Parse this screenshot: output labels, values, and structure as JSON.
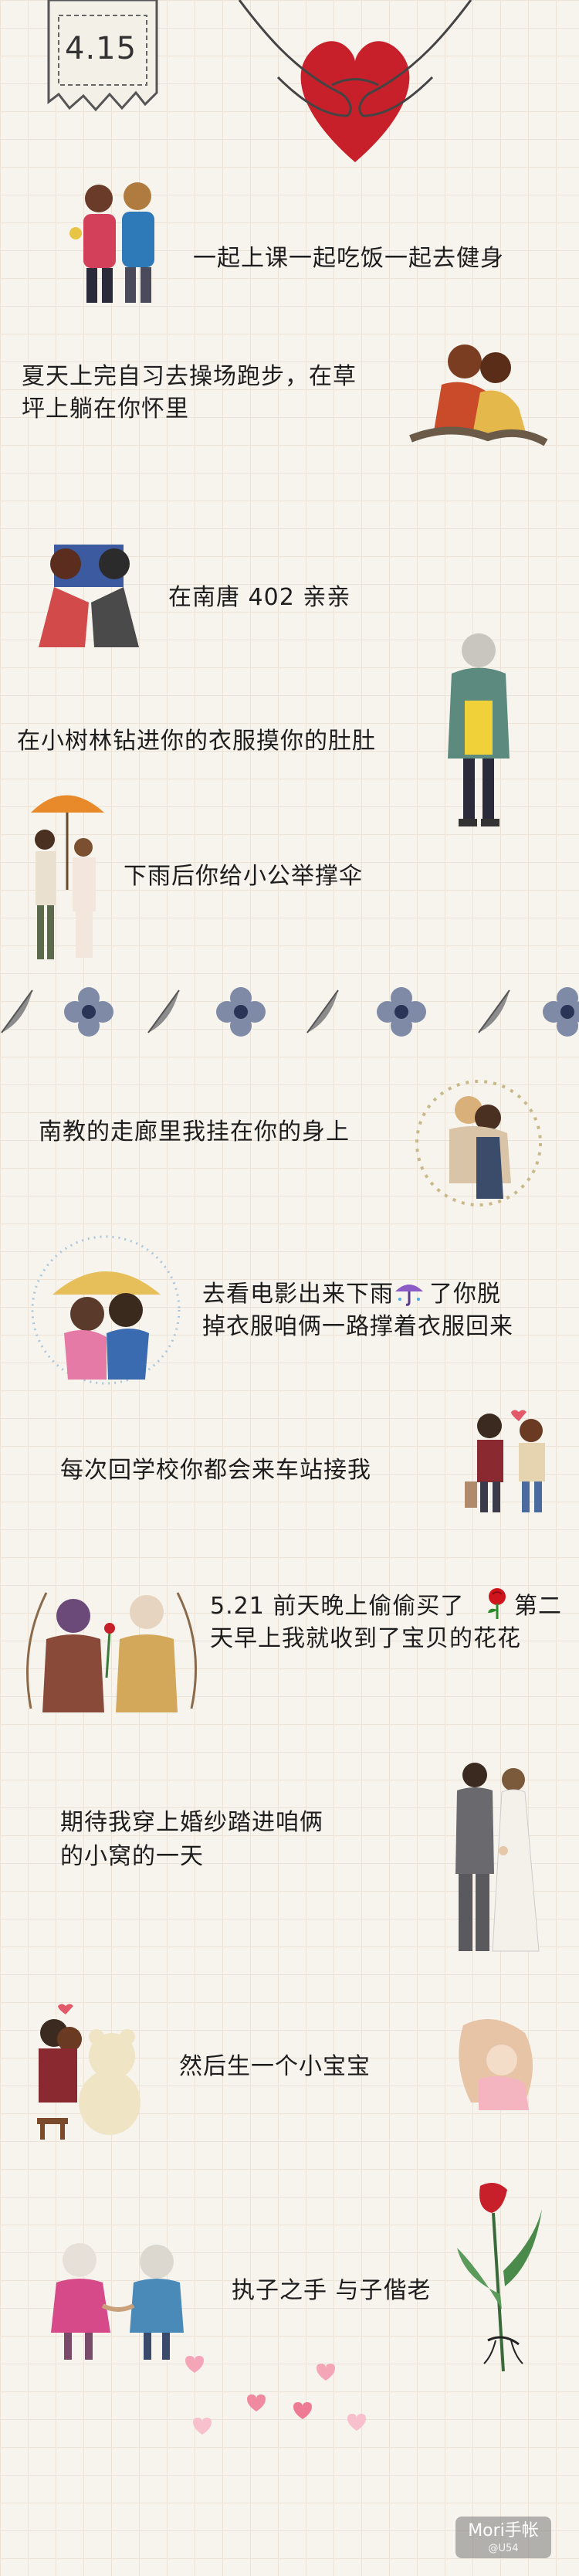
{
  "header": {
    "date": "4.15"
  },
  "lines": [
    "一起上课一起吃饭一起去健身",
    "夏天上完自习去操场跑步，在草",
    "坪上躺在你怀里",
    "在南唐 402 亲亲",
    "在小树林钻进你的衣服摸你的肚肚",
    "下雨后你给小公举撑伞",
    "南教的走廊里我挂在你的身上",
    "去看电影出来下雨",
    "了你脱",
    "掉衣服咱俩一路撑着衣服回来",
    "每次回学校你都会来车站接我",
    "5.21 前天晚上偷偷买了",
    "第二",
    "天早上我就收到了宝贝的花花",
    "期待我穿上婚纱踏进咱俩",
    "的小窝的一天",
    "然后生一个小宝宝",
    "执子之手 与子偕老"
  ],
  "watermark": {
    "brand": "Mori手帐",
    "sub": "@U54"
  },
  "colors": {
    "background": "#f7f4ee",
    "grid": "#ebe3d8",
    "heart": "#c8202a",
    "text": "#1d1d1d"
  },
  "icons": [
    "date-tag-icon",
    "hands-heart-icon",
    "umbrella-emoji-icon",
    "rose-emoji-icon",
    "flower-divider-icon",
    "small-hearts-icon"
  ]
}
